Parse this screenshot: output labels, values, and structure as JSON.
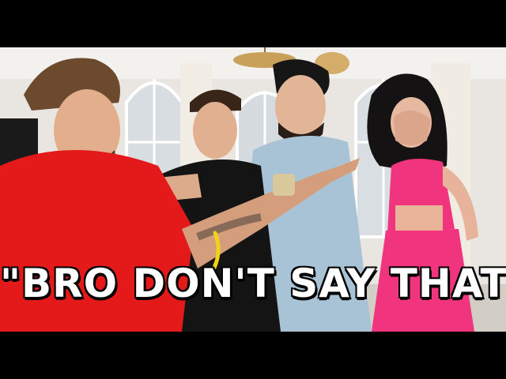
{
  "thumbnail": {
    "caption": "\"BRO DON'T SAY THAT\"",
    "colors": {
      "letterbox": "#000000",
      "wall": "#e9e6e1",
      "red_shirt": "#e41a1a",
      "pink_outfit": "#f0347e",
      "light_blue_hoodie": "#a9c3d6",
      "black_tee": "#141414",
      "caption_fill": "#ffffff",
      "caption_outline": "#000000"
    }
  }
}
